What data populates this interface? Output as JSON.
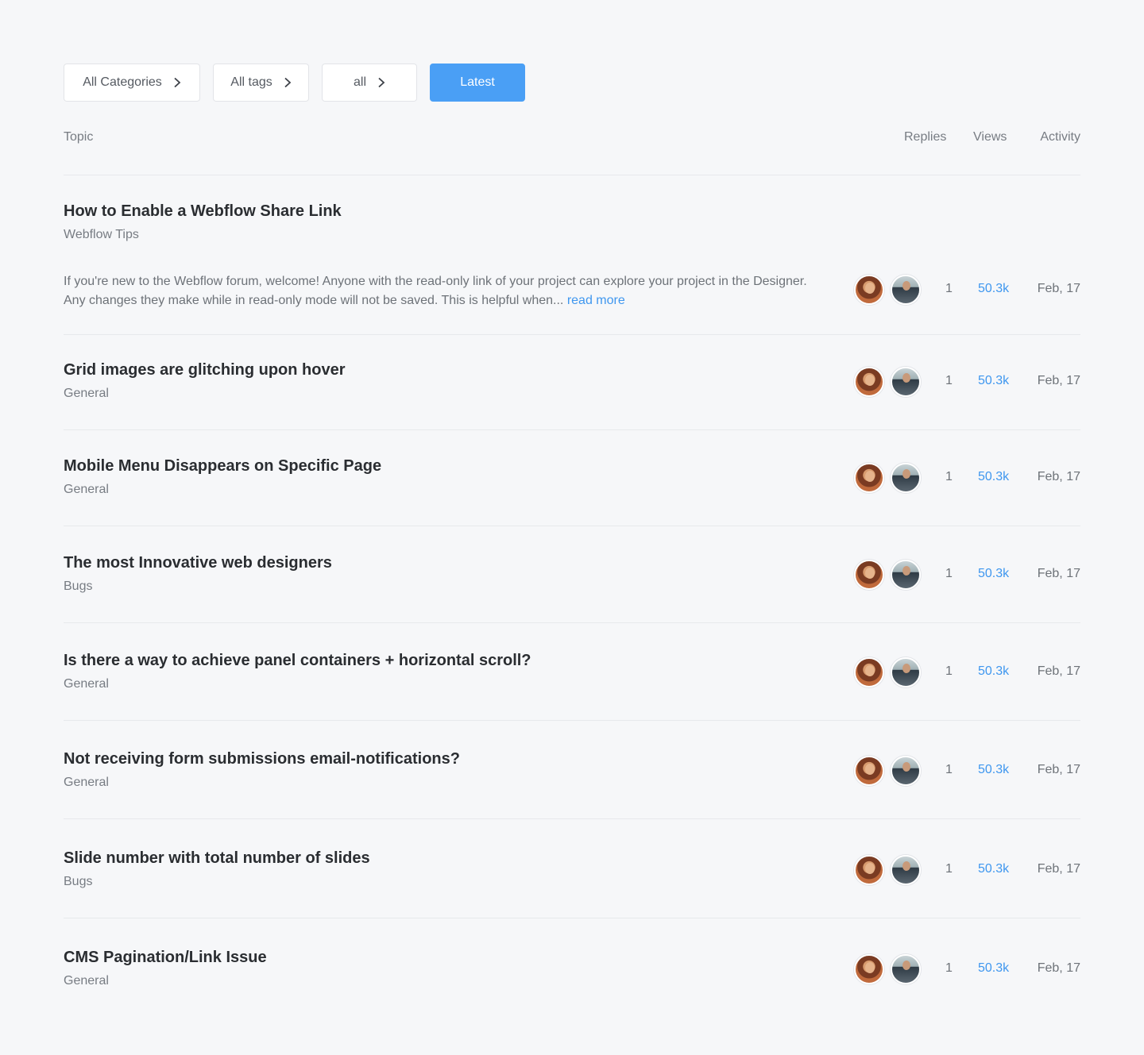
{
  "filters": {
    "categories": "All Categories",
    "tags": "All tags",
    "period": "all",
    "sort": "Latest"
  },
  "table": {
    "topic": "Topic",
    "replies": "Replies",
    "views": "Views",
    "activity": "Activity"
  },
  "topics": [
    {
      "title": "How to Enable a Webflow Share Link",
      "category": "Webflow Tips",
      "excerpt": "If you're new to the Webflow forum, welcome! Anyone with the read-only link of your project can explore your project in the Designer. Any changes they make while in read-only mode will not be saved. This is helpful when...",
      "read_more": "read more",
      "replies": "1",
      "views": "50.3k",
      "activity": "Feb, 17"
    },
    {
      "title": "Grid images are glitching upon hover",
      "category": "General",
      "replies": "1",
      "views": "50.3k",
      "activity": "Feb, 17"
    },
    {
      "title": "Mobile Menu Disappears on Specific Page",
      "category": "General",
      "replies": "1",
      "views": "50.3k",
      "activity": "Feb, 17"
    },
    {
      "title": "The most Innovative web designers",
      "category": "Bugs",
      "replies": "1",
      "views": "50.3k",
      "activity": "Feb, 17"
    },
    {
      "title": "Is there a way to achieve panel containers + horizontal scroll?",
      "category": "General",
      "replies": "1",
      "views": "50.3k",
      "activity": "Feb, 17"
    },
    {
      "title": "Not receiving form submissions email-notifications?",
      "category": "General",
      "replies": "1",
      "views": "50.3k",
      "activity": "Feb, 17"
    },
    {
      "title": "Slide number with total number of slides",
      "category": "Bugs",
      "replies": "1",
      "views": "50.3k",
      "activity": "Feb, 17"
    },
    {
      "title": "CMS Pagination/Link Issue",
      "category": "General",
      "replies": "1",
      "views": "50.3k",
      "activity": "Feb, 17"
    }
  ]
}
